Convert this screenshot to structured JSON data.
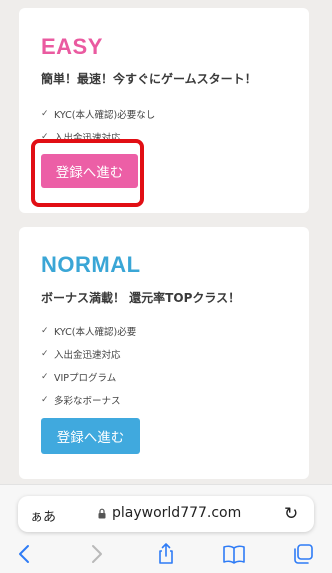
{
  "plans": {
    "easy": {
      "title": "EASY",
      "description": "簡単！最速！今すぐにゲームスタート！",
      "features": [
        "KYC(本人確認)必要なし",
        "入出金迅速対応"
      ],
      "button_label": "登録へ進む",
      "accent": "#ea5aa0"
    },
    "normal": {
      "title": "NORMAL",
      "description": "ボーナス満載！ 還元率TOPクラス！",
      "features": [
        "KYC(本人確認)必要",
        "入出金迅速対応",
        "VIPプログラム",
        "多彩なボーナス"
      ],
      "button_label": "登録へ進む",
      "accent": "#3aa6d6"
    }
  },
  "check_glyph": "✓",
  "browser": {
    "text_size_label": "ぁあ",
    "url": "playworld777.com",
    "icons": [
      "lock-icon",
      "reload-icon",
      "back-icon",
      "forward-icon",
      "share-icon",
      "bookmarks-icon",
      "tabs-icon"
    ]
  },
  "colors": {
    "highlight": "#e10e14",
    "ios_blue": "#2f7cf6",
    "background": "#efedeb"
  }
}
